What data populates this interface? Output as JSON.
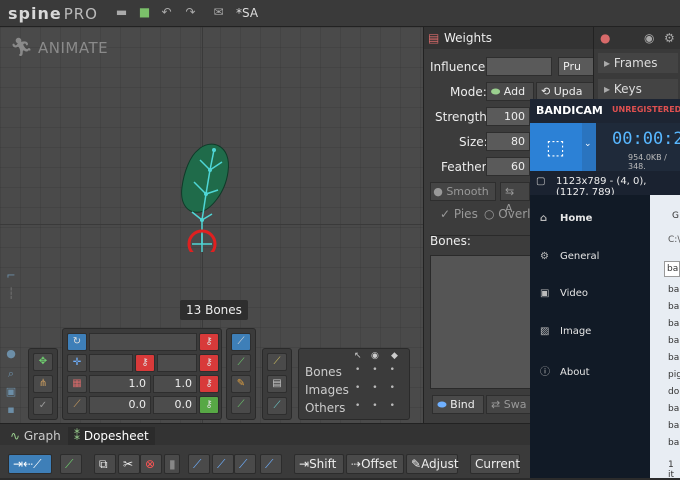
{
  "app": {
    "logo_text": "spine",
    "logo_pro": "PRO",
    "project_name": "*SA"
  },
  "viewport": {
    "mode_label": "ANIMATE",
    "bones_tooltip": "13 Bones"
  },
  "transform_tools": {
    "scale_x": "1.0",
    "scale_y": "1.0",
    "shear_x": "0.0",
    "shear_y": "0.0"
  },
  "visibility": {
    "rows": [
      "Bones",
      "Images",
      "Others"
    ]
  },
  "timeline": {
    "tabs": [
      "Graph",
      "Dopesheet"
    ],
    "active_tab": "Dopesheet",
    "buttons": {
      "shift": "Shift",
      "offset": "Offset",
      "adjust": "Adjust",
      "current": "Current"
    }
  },
  "weights": {
    "title": "Weights",
    "influence_label": "Influence:",
    "influence_btn": "Pru",
    "mode_label": "Mode:",
    "add_label": "Add",
    "update_label": "Upda",
    "strength_label": "Strength:",
    "strength_value": "100",
    "size_label": "Size:",
    "size_value": "80",
    "feather_label": "Feather:",
    "feather_value": "60",
    "smooth_label": "Smooth",
    "a_label": "A",
    "pies_label": "Pies",
    "overlay_label": "Overla",
    "bones_label": "Bones:",
    "bind_label": "Bind",
    "swap_label": "Swa"
  },
  "right_panel": {
    "frames_label": "Frames",
    "keys_label": "Keys"
  },
  "bandicam": {
    "brand": "BANDICAM",
    "registration": "UNREGISTERED",
    "timer": "00:00:2",
    "size_info": "954.0KB / 348.",
    "resolution": "1123x789 - (4, 0), (1127, 789)",
    "menu": [
      "Home",
      "General",
      "Video",
      "Image",
      "About"
    ],
    "list_header": "G",
    "list_path": "C:\\",
    "list_items": [
      "ba",
      "ba",
      "ba",
      "ba",
      "ba",
      "ba",
      "pig",
      "do",
      "ba",
      "ba",
      "ba"
    ],
    "list_footer": "1 it"
  },
  "colors": {
    "accent_blue": "#3e7fb8",
    "key_red": "#d83a3a",
    "key_green": "#57a845",
    "bone_cyan": "#4fd6d6",
    "mesh_green": "#1f6b4a",
    "root_red": "#e02020"
  }
}
